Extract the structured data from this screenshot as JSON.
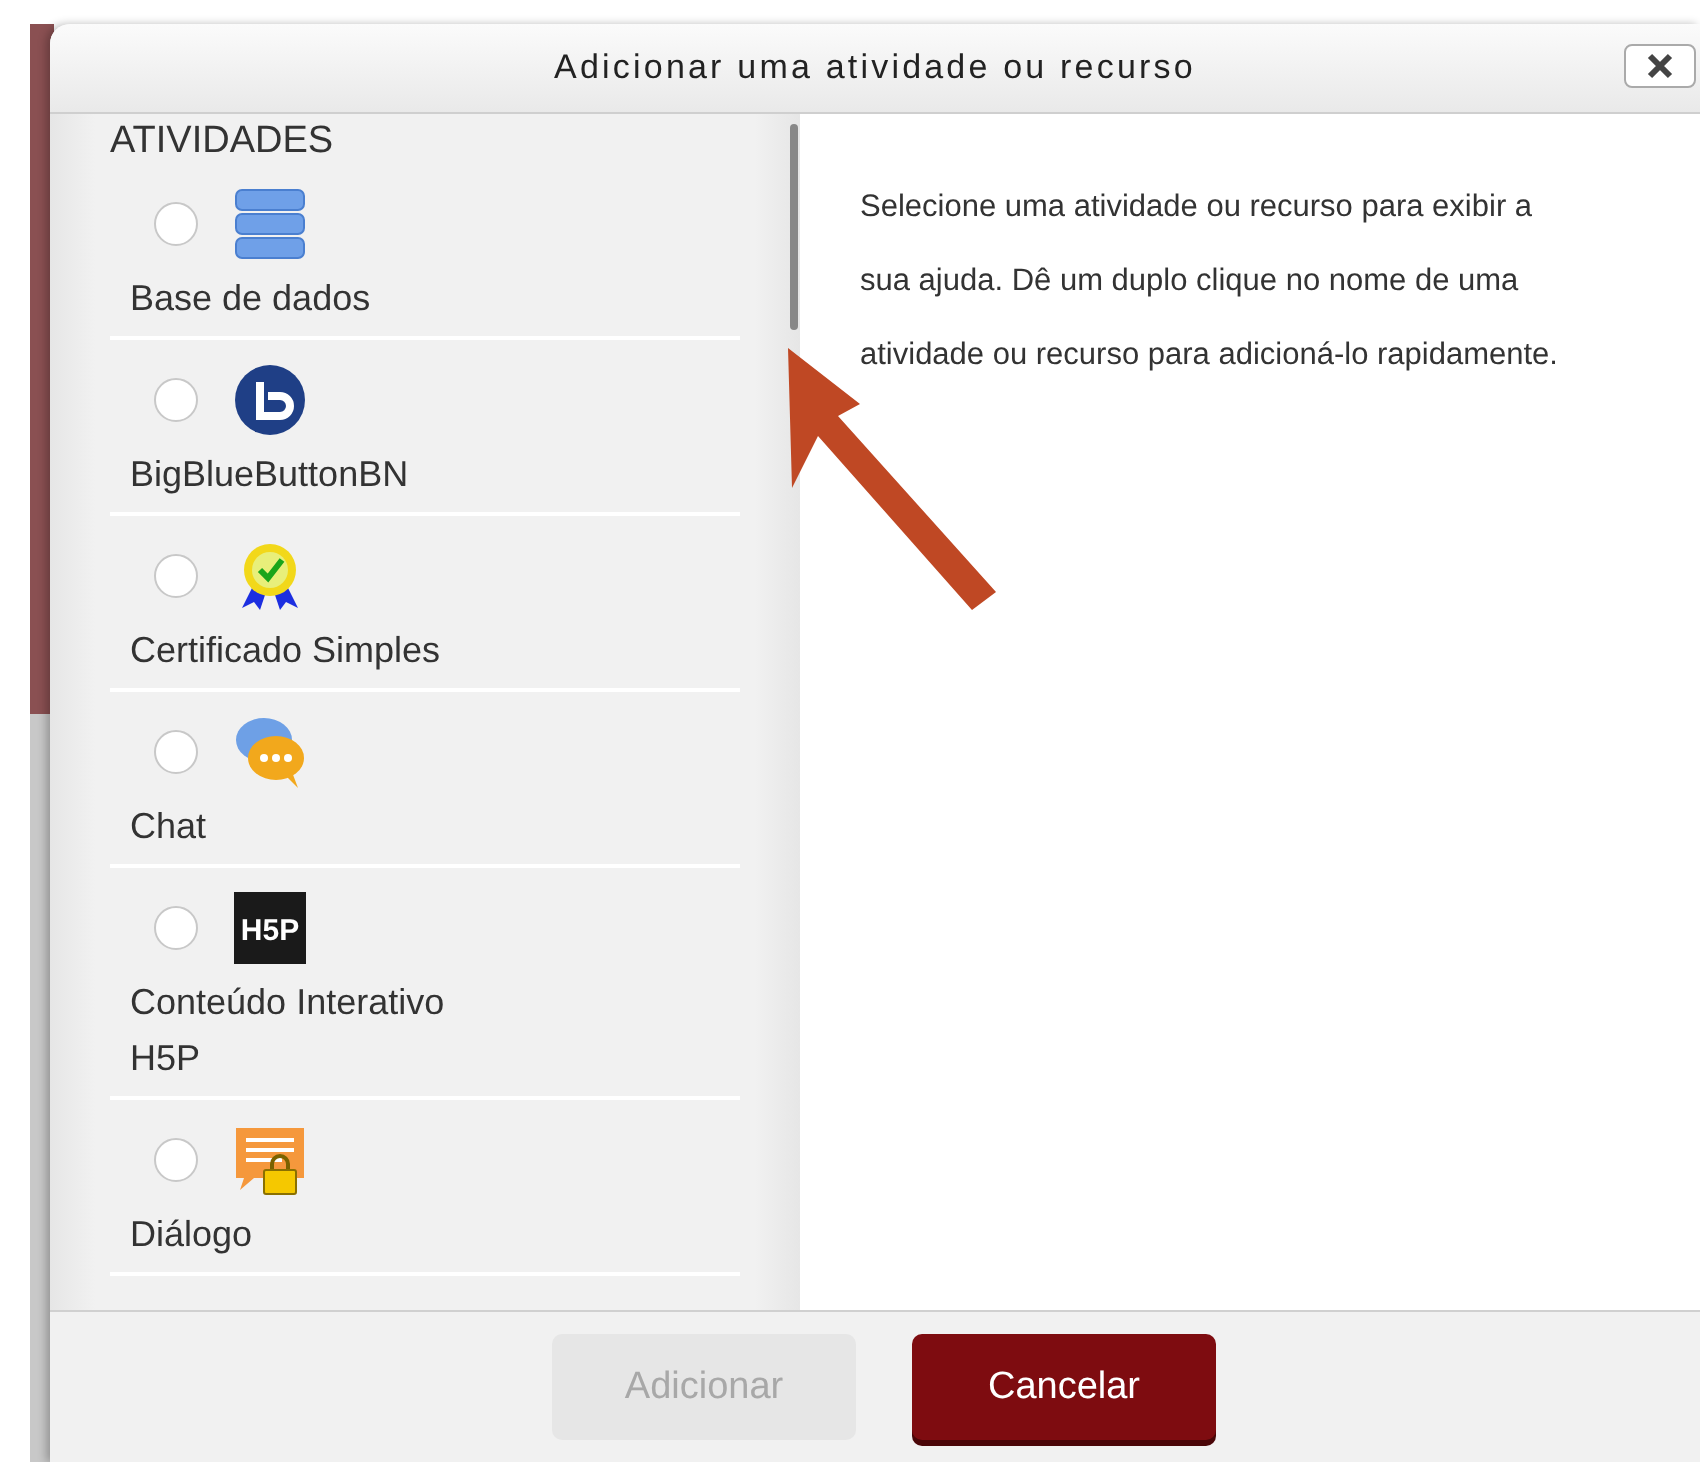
{
  "dialog": {
    "title": "Adicionar uma atividade ou recurso"
  },
  "section": "ATIVIDADES",
  "items": [
    {
      "label": "Base de dados",
      "kind": "database",
      "selected": false
    },
    {
      "label": "BigBlueButtonBN",
      "kind": "conference",
      "selected": false
    },
    {
      "label": "Certificado Simples",
      "kind": "certificate",
      "selected": false
    },
    {
      "label": "Chat",
      "kind": "chat",
      "selected": false
    },
    {
      "label": "Conteúdo Interativo H5P",
      "kind": "interactive",
      "icon_text": "H5P",
      "selected": false
    },
    {
      "label": "Diálogo",
      "kind": "dialogue",
      "selected": false
    }
  ],
  "help": "Selecione uma atividade ou recurso para exibir a sua ajuda. Dê um duplo clique no nome de uma atividade ou recurso para adicioná-lo rapidamente.",
  "buttons": [
    {
      "label": "Adicionar",
      "disabled": true
    },
    {
      "label": "Cancelar",
      "disabled": false
    }
  ]
}
